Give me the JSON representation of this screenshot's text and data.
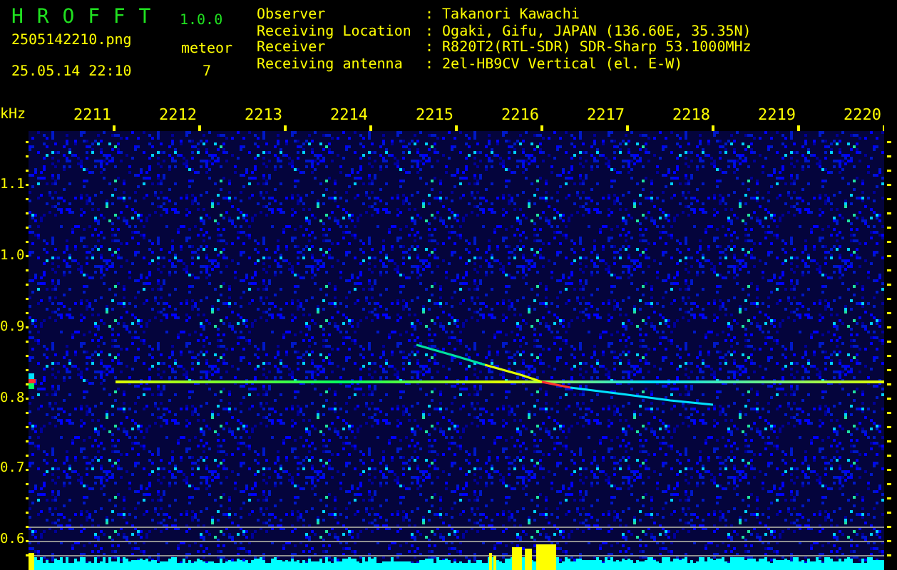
{
  "app": {
    "name": "H R O F F T",
    "version": "1.0.0"
  },
  "capture": {
    "filename": "2505142210.png",
    "datetime": "25.05.14 22:10"
  },
  "meteor": {
    "label": "meteor",
    "count": "7"
  },
  "info": [
    {
      "label": "Observer",
      "value": ": Takanori Kawachi"
    },
    {
      "label": "Receiving Location",
      "value": ": Ogaki, Gifu, JAPAN (136.60E, 35.35N)"
    },
    {
      "label": "Receiver",
      "value": ": R820T2(RTL-SDR) SDR-Sharp 53.1000MHz"
    },
    {
      "label": "Receiving antenna",
      "value": ": 2el-HB9CV Vertical (el. E-W)"
    }
  ],
  "x_axis": [
    "2211",
    "2212",
    "2213",
    "2214",
    "2215",
    "2216",
    "2217",
    "2218",
    "2219",
    "2220"
  ],
  "y_axis": {
    "unit": "kHz",
    "labels": [
      "1.1",
      "1.0",
      "0.9",
      "0.8",
      "0.7",
      "0.6"
    ]
  }
}
